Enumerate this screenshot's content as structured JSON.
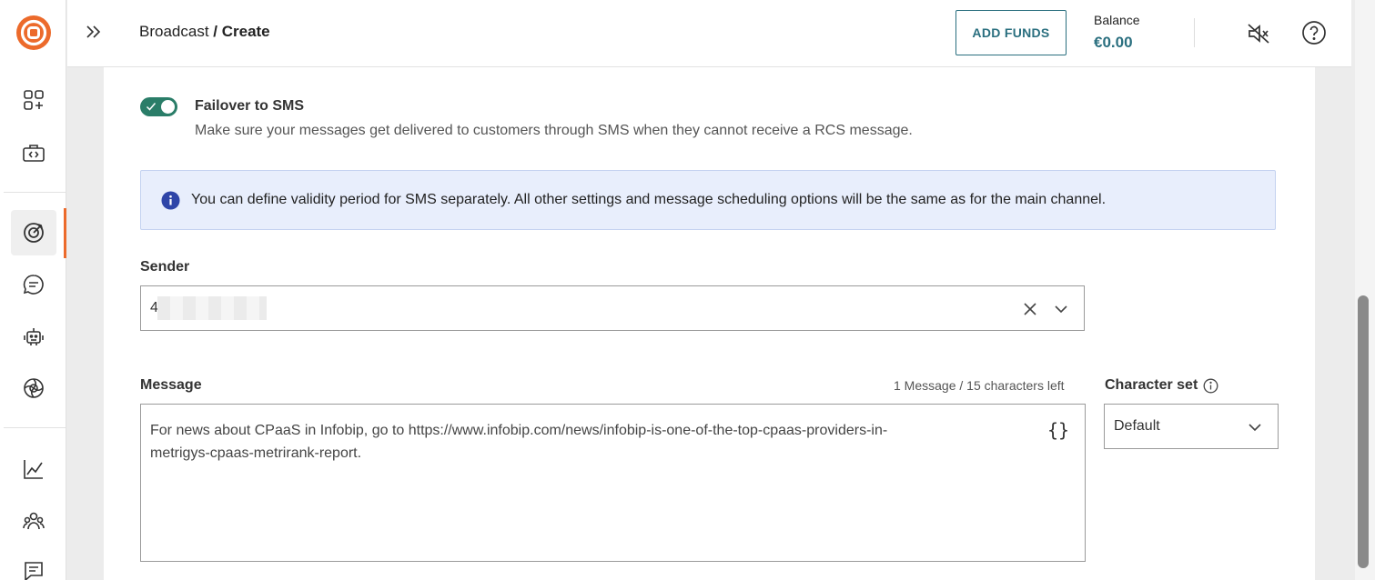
{
  "header": {
    "breadcrumb_parent": "Broadcast",
    "breadcrumb_sep": " / ",
    "breadcrumb_current": "Create",
    "add_funds_label": "ADD FUNDS",
    "balance_label": "Balance",
    "balance_value": "€0.00"
  },
  "sidebar": {
    "items": [
      {
        "icon": "apps-add-icon"
      },
      {
        "icon": "developer-briefcase-icon"
      },
      {
        "icon": "target-icon",
        "active": true
      },
      {
        "icon": "chat-bubble-icon"
      },
      {
        "icon": "robot-icon"
      },
      {
        "icon": "ai-aperture-icon"
      },
      {
        "icon": "analytics-chart-icon"
      },
      {
        "icon": "people-icon"
      },
      {
        "icon": "message-list-icon"
      }
    ]
  },
  "failover": {
    "enabled": true,
    "title": "Failover to SMS",
    "description": "Make sure your messages get delivered to customers through SMS when they cannot receive a RCS message."
  },
  "info": {
    "text": "You can define validity period for SMS separately. All other settings and message scheduling options will be the same as for the main channel."
  },
  "sender": {
    "label": "Sender",
    "value": "4"
  },
  "message": {
    "label": "Message",
    "count": "1 Message / 15 characters left",
    "text": "For news about CPaaS in Infobip, go to https://www.infobip.com/news/infobip-is-one-of-the-top-cpaas-providers-in-\nmetrigys-cpaas-metrirank-report.",
    "placeholder_button": "{}"
  },
  "charset": {
    "label": "Character set",
    "value": "Default"
  },
  "colors": {
    "accent": "#ec6a2b",
    "teal": "#2a6f7f",
    "toggle_on": "#2a7d68",
    "info_bg": "#e8eefc",
    "info_icon": "#2f45a8"
  }
}
